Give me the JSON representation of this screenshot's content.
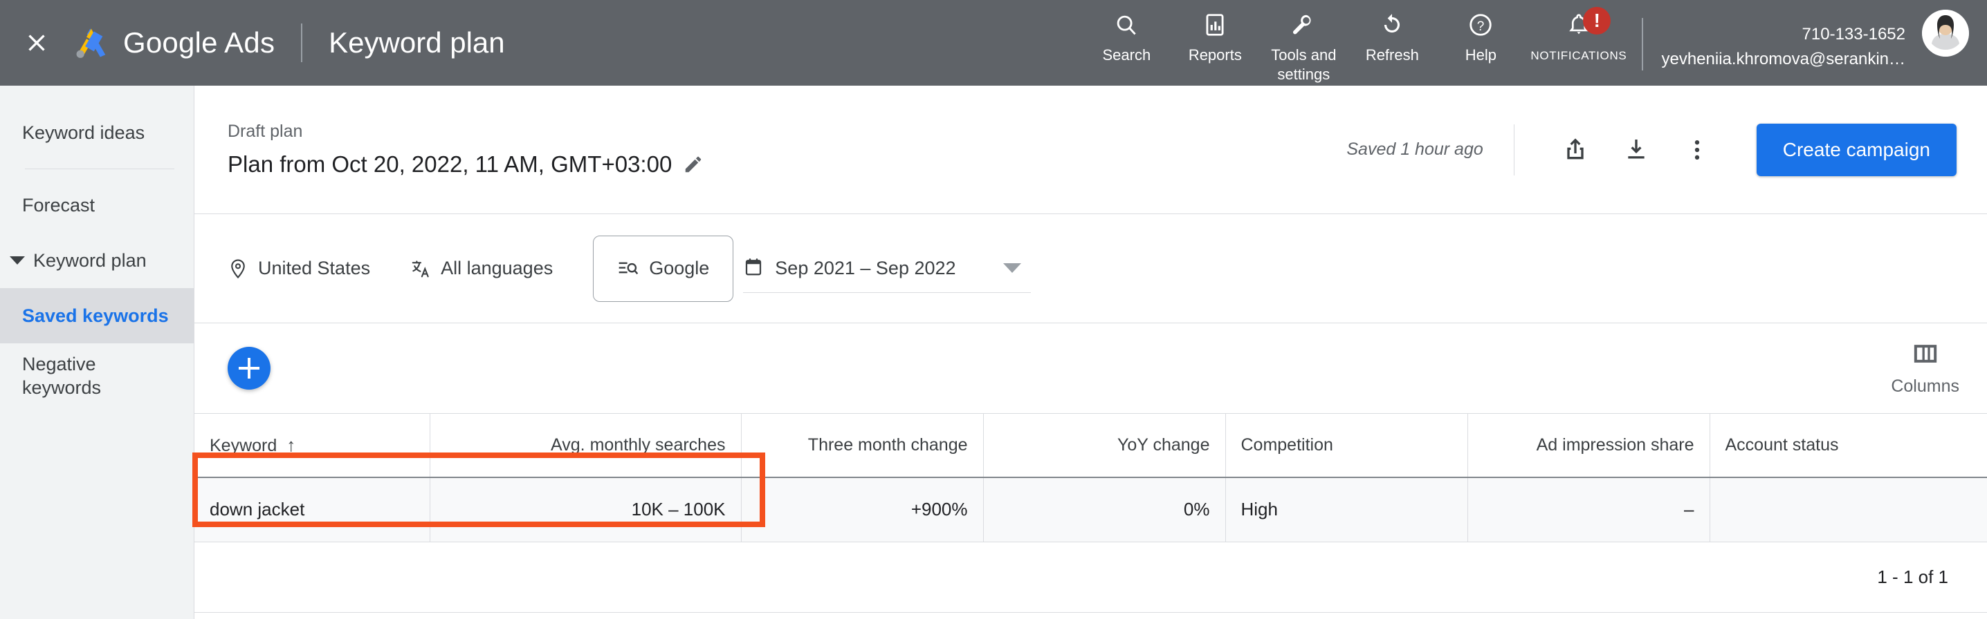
{
  "topbar": {
    "close_label": "×",
    "brand": "Google Ads",
    "page_title": "Keyword plan",
    "actions": [
      {
        "label": "Search",
        "icon": "search-icon"
      },
      {
        "label": "Reports",
        "icon": "reports-icon"
      },
      {
        "label": "Tools and\nsettings",
        "icon": "tools-icon"
      },
      {
        "label": "Refresh",
        "icon": "refresh-icon"
      },
      {
        "label": "Help",
        "icon": "help-icon"
      }
    ],
    "notifications": {
      "label": "NOTIFICATIONS",
      "badge": "!",
      "badge_color": "#C5342B"
    },
    "account": {
      "id": "710-133-1652",
      "email": "yevheniia.khromova@serankin…"
    },
    "bg_color": "#5F6368"
  },
  "sidebar": {
    "items": [
      {
        "label": "Keyword ideas",
        "selected": false,
        "expandable": false
      },
      {
        "label": "Forecast",
        "selected": false,
        "expandable": false
      },
      {
        "label": "Keyword plan",
        "selected": false,
        "expandable": true
      },
      {
        "label": "Saved keywords",
        "selected": true,
        "expandable": false
      },
      {
        "label": "Negative\nkeywords",
        "selected": false,
        "expandable": false
      }
    ],
    "selected_color": "#1A73E8"
  },
  "plan_header": {
    "draft_label": "Draft plan",
    "plan_name": "Plan from Oct 20, 2022, 11 AM, GMT+03:00",
    "edit_icon": "pencil-icon",
    "saved_note": "Saved 1 hour ago",
    "share_icon": "share-icon",
    "download_icon": "download-icon",
    "more_icon": "more-vert-icon",
    "create_campaign_label": "Create campaign",
    "accent_color": "#1A73E8"
  },
  "filters": {
    "location": {
      "label": "United States",
      "icon": "location-pin-icon"
    },
    "languages": {
      "label": "All languages",
      "icon": "translate-icon"
    },
    "network": {
      "label": "Google",
      "icon": "search-list-icon"
    },
    "date_range": {
      "label": "Sep 2021 – Sep 2022",
      "icon": "calendar-icon"
    }
  },
  "toolbar": {
    "add_label": "+",
    "columns_label": "Columns",
    "columns_icon": "columns-icon"
  },
  "table": {
    "columns": [
      {
        "label": "Keyword",
        "align": "txt",
        "sorted": true,
        "sort_arrow": "↑"
      },
      {
        "label": "Avg. monthly searches",
        "align": "num"
      },
      {
        "label": "Three month change",
        "align": "num"
      },
      {
        "label": "YoY change",
        "align": "num"
      },
      {
        "label": "Competition",
        "align": "txt"
      },
      {
        "label": "Ad impression share",
        "align": "num"
      },
      {
        "label": "Account status",
        "align": "txt"
      }
    ],
    "rows": [
      {
        "keyword": "down jacket",
        "avg_monthly_searches": "10K – 100K",
        "three_month_change": "+900%",
        "yoy_change": "0%",
        "competition": "High",
        "ad_impression_share": "–",
        "account_status": ""
      }
    ],
    "pagination": "1 - 1 of 1"
  },
  "annotation": {
    "color": "#F4511E",
    "note": "red highlight rectangle around keyword and avg. monthly searches cells"
  }
}
